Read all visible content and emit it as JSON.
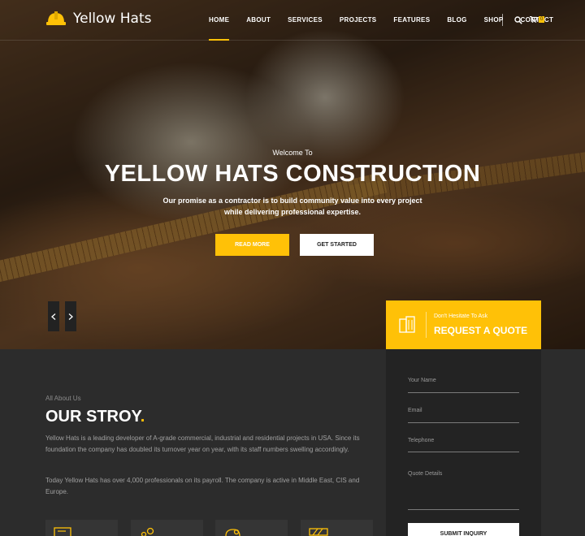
{
  "brand": {
    "name": "Yellow Hats",
    "accent": "#ffc107"
  },
  "nav": {
    "items": [
      "HOME",
      "ABOUT",
      "SERVICES",
      "PROJECTS",
      "FEATURES",
      "BLOG",
      "SHOP",
      "CONTACT"
    ],
    "active": "HOME",
    "cart_count": "0"
  },
  "hero": {
    "welcome": "Welcome To",
    "title": "YELLOW HATS CONSTRUCTION",
    "subtitle_line1": "Our promise as a contractor is to build community value into every project",
    "subtitle_line2": "while delivering professional expertise.",
    "read_more": "READ MORE",
    "get_started": "GET STARTED",
    "prev_icon": "chevron-left-icon",
    "next_icon": "chevron-right-icon"
  },
  "quote": {
    "small": "Don't Hesitate To Ask",
    "big": "REQUEST A QUOTE"
  },
  "about": {
    "kicker": "All About Us",
    "title": "OUR STROY",
    "title_dot": ".",
    "p1": "Yellow Hats is a leading developer of A-grade commercial, industrial and residential projects in USA. Since its foundation the company has doubled its turnover year on year, with its staff numbers swelling accordingly.",
    "p2": "Today Yellow Hats has over 4,000 professionals on its payroll. The company is active in Middle East, CIS and Europe."
  },
  "form": {
    "name_label": "Your Name",
    "email_label": "Email",
    "phone_label": "Telephone",
    "details_label": "Quote Details",
    "submit": "SUBMIT INQUIRY"
  }
}
